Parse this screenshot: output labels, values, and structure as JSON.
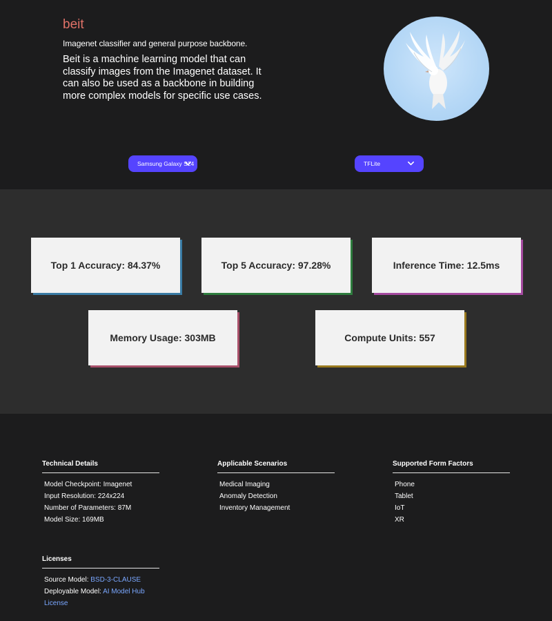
{
  "hero": {
    "title": "beit",
    "subtitle": "Imagenet classifier and general purpose backbone.",
    "description": "Beit is a machine learning model that can classify images from the Imagenet dataset. It can also be used as a backbone in building more complex models for specific use cases.",
    "image_subject": "white dove in flight against blue sky"
  },
  "selectors": {
    "device": "Samsung Galaxy S24",
    "runtime": "TFLite"
  },
  "metrics": [
    {
      "label": "Top 1 Accuracy: 84.37%",
      "accent": "#3a7ca5"
    },
    {
      "label": "Top 5 Accuracy: 97.28%",
      "accent": "#2e7d3e"
    },
    {
      "label": "Inference Time: 12.5ms",
      "accent": "#a54aa0"
    },
    {
      "label": "Memory Usage: 303MB",
      "accent": "#a8506a"
    },
    {
      "label": "Compute Units: 557",
      "accent": "#9a7a1e"
    }
  ],
  "footer": {
    "technical": {
      "heading": "Technical Details",
      "items": [
        "Model Checkpoint: Imagenet",
        "Input Resolution: 224x224",
        "Number of Parameters: 87M",
        "Model Size: 169MB"
      ]
    },
    "scenarios": {
      "heading": "Applicable Scenarios",
      "items": [
        "Medical Imaging",
        "Anomaly Detection",
        "Inventory Management"
      ]
    },
    "form_factors": {
      "heading": "Supported Form Factors",
      "items": [
        "Phone",
        "Tablet",
        "IoT",
        "XR"
      ]
    },
    "licenses": {
      "heading": "Licenses",
      "source_label": "Source Model: ",
      "source_link": "BSD-3-CLAUSE",
      "deployable_label": "Deployable Model: ",
      "deployable_link": "AI Model Hub License"
    }
  },
  "colors": {
    "accent_button": "#5544ff",
    "title": "#e07268",
    "link": "#7aa7ff"
  }
}
